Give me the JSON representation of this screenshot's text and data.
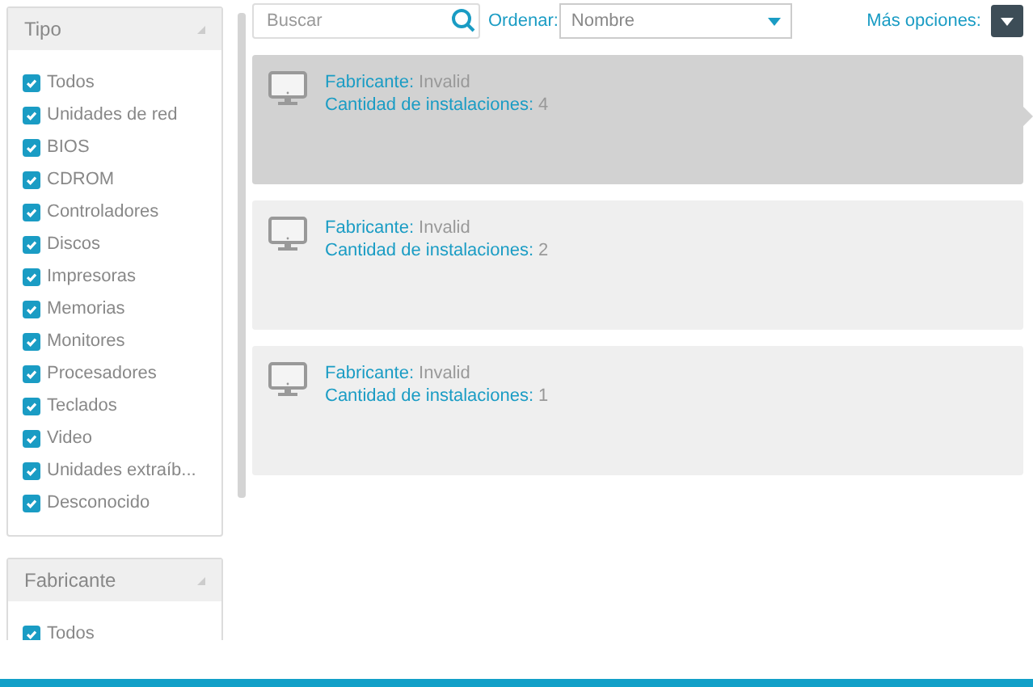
{
  "filters": [
    {
      "title": "Tipo",
      "items": [
        {
          "label": "Todos",
          "checked": true
        },
        {
          "label": "Unidades de red",
          "checked": true
        },
        {
          "label": "BIOS",
          "checked": true
        },
        {
          "label": "CDROM",
          "checked": true
        },
        {
          "label": "Controladores",
          "checked": true
        },
        {
          "label": "Discos",
          "checked": true
        },
        {
          "label": "Impresoras",
          "checked": true
        },
        {
          "label": "Memorias",
          "checked": true
        },
        {
          "label": "Monitores",
          "checked": true
        },
        {
          "label": "Procesadores",
          "checked": true
        },
        {
          "label": "Teclados",
          "checked": true
        },
        {
          "label": "Video",
          "checked": true
        },
        {
          "label": "Unidades extraíb...",
          "checked": true
        },
        {
          "label": "Desconocido",
          "checked": true
        }
      ]
    },
    {
      "title": "Fabricante",
      "items": [
        {
          "label": "Todos",
          "checked": true
        }
      ]
    }
  ],
  "toolbar": {
    "search": {
      "placeholder": "Buscar"
    },
    "sort_label": "Ordenar:",
    "sort_value": "Nombre",
    "more_label": "Más opciones:"
  },
  "cards": [
    {
      "selected": true,
      "fields": [
        {
          "label": "Fabricante:",
          "value": "Invalid"
        },
        {
          "label": "Cantidad de instalaciones:",
          "value": "4"
        }
      ]
    },
    {
      "selected": false,
      "fields": [
        {
          "label": "Fabricante:",
          "value": "Invalid"
        },
        {
          "label": "Cantidad de instalaciones:",
          "value": "2"
        }
      ]
    },
    {
      "selected": false,
      "fields": [
        {
          "label": "Fabricante:",
          "value": "Invalid"
        },
        {
          "label": "Cantidad de instalaciones:",
          "value": "1"
        }
      ]
    }
  ]
}
